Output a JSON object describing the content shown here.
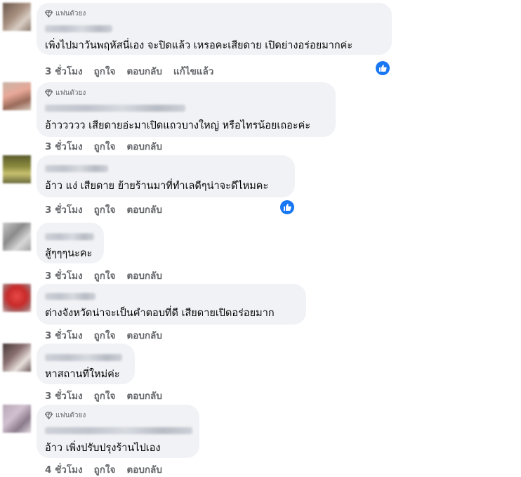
{
  "fan_badge": {
    "label": "แฟนตัวยง",
    "icon": "diamond-icon"
  },
  "actions": {
    "like": "ถูกใจ",
    "reply": "ตอบกลับ",
    "edited": "แก้ไขแล้ว"
  },
  "comments": [
    {
      "time": "3 ชั่วโมง",
      "text": "เพิ่งไปมาวันพฤหัสนี่เอง จะปิดแล้ว เหรอคะเสียดาย เปิดย่างอร่อยมากค่ะ",
      "top_fan": true,
      "edited": true,
      "reaction": "like-reaction-icon"
    },
    {
      "time": "3 ชั่วโมง",
      "text": "อ้าววววว เสียดายอ่ะมาเปิดแถวบางใหญ่ หรือไทรน้อยเถอะค่ะ",
      "top_fan": true,
      "edited": false
    },
    {
      "time": "3 ชั่วโมง",
      "text": "อ้าว แง่ เสียดาย ย้ายร้านมาที่ทำเลดีๆน่าจะดีไหมคะ",
      "top_fan": false,
      "edited": false,
      "reaction": "like-reaction-icon"
    },
    {
      "time": "3 ชั่วโมง",
      "text": "สู้ๆๆๆนะคะ",
      "top_fan": false,
      "edited": false
    },
    {
      "time": "3 ชั่วโมง",
      "text": "ต่างจังหวัดน่าจะเป็นคำตอบที่ดี เสียดายเปิดอร่อยมาก",
      "top_fan": false,
      "edited": false
    },
    {
      "time": "3 ชั่วโมง",
      "text": "หาสถานที่ใหม่ค่ะ",
      "top_fan": false,
      "edited": false
    },
    {
      "time": "4 ชั่วโมง",
      "text": "อ้าว เพิ่งปรับปรุงร้านไปเอง",
      "top_fan": true,
      "edited": false
    }
  ]
}
